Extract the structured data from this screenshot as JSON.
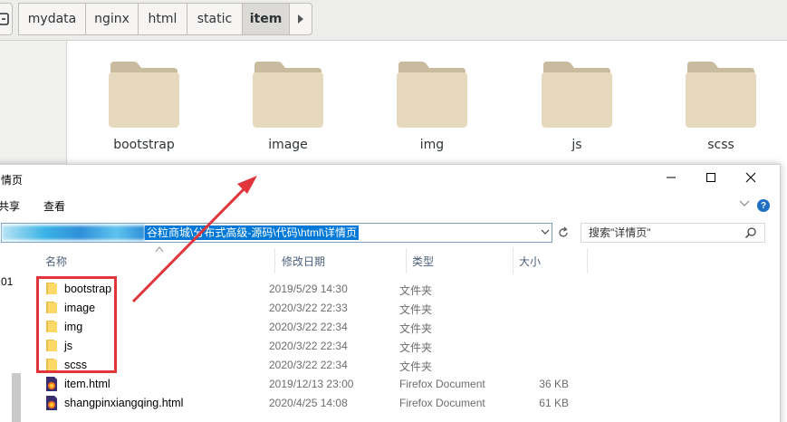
{
  "file_manager": {
    "breadcrumbs": [
      "mydata",
      "nginx",
      "html",
      "static",
      "item"
    ],
    "active_crumb": "item",
    "icons": [
      {
        "label": "bootstrap",
        "icon": "folder-icon"
      },
      {
        "label": "image",
        "icon": "folder-icon"
      },
      {
        "label": "img",
        "icon": "folder-icon"
      },
      {
        "label": "js",
        "icon": "folder-icon"
      },
      {
        "label": "scss",
        "icon": "folder-icon"
      }
    ]
  },
  "explorer": {
    "title": "情页",
    "ribbon": {
      "share": "共享",
      "view": "查看"
    },
    "address": "谷粒商城\\分布式高级-源码\\代码\\html\\详情页",
    "search_placeholder": "搜索\"详情页\"",
    "nav_label": "01",
    "columns": {
      "name": "名称",
      "date": "修改日期",
      "type": "类型",
      "size": "大小"
    },
    "files": [
      {
        "name": "bootstrap",
        "date": "2019/5/29 14:30",
        "type": "文件夹",
        "size": "",
        "icon": "folder-icon"
      },
      {
        "name": "image",
        "date": "2020/3/22 22:33",
        "type": "文件夹",
        "size": "",
        "icon": "folder-icon"
      },
      {
        "name": "img",
        "date": "2020/3/22 22:34",
        "type": "文件夹",
        "size": "",
        "icon": "folder-icon"
      },
      {
        "name": "js",
        "date": "2020/3/22 22:34",
        "type": "文件夹",
        "size": "",
        "icon": "folder-icon"
      },
      {
        "name": "scss",
        "date": "2020/3/22 22:34",
        "type": "文件夹",
        "size": "",
        "icon": "folder-icon"
      },
      {
        "name": "item.html",
        "date": "2019/12/13 23:00",
        "type": "Firefox Document",
        "size": "36 KB",
        "icon": "firefox-html-icon"
      },
      {
        "name": "shangpinxiangqing.html",
        "date": "2020/4/25 14:08",
        "type": "Firefox Document",
        "size": "61 KB",
        "icon": "firefox-html-icon"
      }
    ]
  },
  "colors": {
    "annotation_red": "#e0353b",
    "address_selection": "#0078d7",
    "folder_tan": "#e6d9be"
  }
}
